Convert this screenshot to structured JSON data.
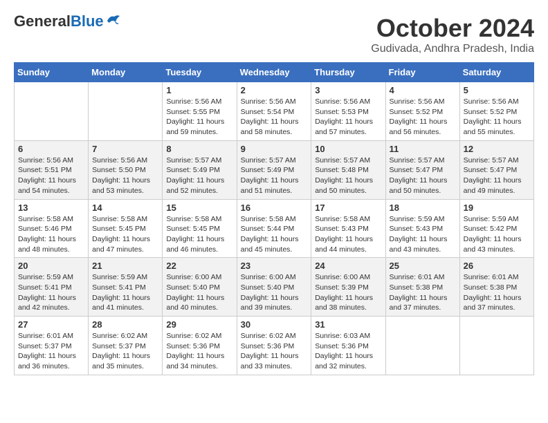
{
  "header": {
    "logo_general": "General",
    "logo_blue": "Blue",
    "month_title": "October 2024",
    "location": "Gudivada, Andhra Pradesh, India"
  },
  "days_of_week": [
    "Sunday",
    "Monday",
    "Tuesday",
    "Wednesday",
    "Thursday",
    "Friday",
    "Saturday"
  ],
  "weeks": [
    [
      {
        "day": "",
        "sunrise": "",
        "sunset": "",
        "daylight": ""
      },
      {
        "day": "",
        "sunrise": "",
        "sunset": "",
        "daylight": ""
      },
      {
        "day": "1",
        "sunrise": "Sunrise: 5:56 AM",
        "sunset": "Sunset: 5:55 PM",
        "daylight": "Daylight: 11 hours and 59 minutes."
      },
      {
        "day": "2",
        "sunrise": "Sunrise: 5:56 AM",
        "sunset": "Sunset: 5:54 PM",
        "daylight": "Daylight: 11 hours and 58 minutes."
      },
      {
        "day": "3",
        "sunrise": "Sunrise: 5:56 AM",
        "sunset": "Sunset: 5:53 PM",
        "daylight": "Daylight: 11 hours and 57 minutes."
      },
      {
        "day": "4",
        "sunrise": "Sunrise: 5:56 AM",
        "sunset": "Sunset: 5:52 PM",
        "daylight": "Daylight: 11 hours and 56 minutes."
      },
      {
        "day": "5",
        "sunrise": "Sunrise: 5:56 AM",
        "sunset": "Sunset: 5:52 PM",
        "daylight": "Daylight: 11 hours and 55 minutes."
      }
    ],
    [
      {
        "day": "6",
        "sunrise": "Sunrise: 5:56 AM",
        "sunset": "Sunset: 5:51 PM",
        "daylight": "Daylight: 11 hours and 54 minutes."
      },
      {
        "day": "7",
        "sunrise": "Sunrise: 5:56 AM",
        "sunset": "Sunset: 5:50 PM",
        "daylight": "Daylight: 11 hours and 53 minutes."
      },
      {
        "day": "8",
        "sunrise": "Sunrise: 5:57 AM",
        "sunset": "Sunset: 5:49 PM",
        "daylight": "Daylight: 11 hours and 52 minutes."
      },
      {
        "day": "9",
        "sunrise": "Sunrise: 5:57 AM",
        "sunset": "Sunset: 5:49 PM",
        "daylight": "Daylight: 11 hours and 51 minutes."
      },
      {
        "day": "10",
        "sunrise": "Sunrise: 5:57 AM",
        "sunset": "Sunset: 5:48 PM",
        "daylight": "Daylight: 11 hours and 50 minutes."
      },
      {
        "day": "11",
        "sunrise": "Sunrise: 5:57 AM",
        "sunset": "Sunset: 5:47 PM",
        "daylight": "Daylight: 11 hours and 50 minutes."
      },
      {
        "day": "12",
        "sunrise": "Sunrise: 5:57 AM",
        "sunset": "Sunset: 5:47 PM",
        "daylight": "Daylight: 11 hours and 49 minutes."
      }
    ],
    [
      {
        "day": "13",
        "sunrise": "Sunrise: 5:58 AM",
        "sunset": "Sunset: 5:46 PM",
        "daylight": "Daylight: 11 hours and 48 minutes."
      },
      {
        "day": "14",
        "sunrise": "Sunrise: 5:58 AM",
        "sunset": "Sunset: 5:45 PM",
        "daylight": "Daylight: 11 hours and 47 minutes."
      },
      {
        "day": "15",
        "sunrise": "Sunrise: 5:58 AM",
        "sunset": "Sunset: 5:45 PM",
        "daylight": "Daylight: 11 hours and 46 minutes."
      },
      {
        "day": "16",
        "sunrise": "Sunrise: 5:58 AM",
        "sunset": "Sunset: 5:44 PM",
        "daylight": "Daylight: 11 hours and 45 minutes."
      },
      {
        "day": "17",
        "sunrise": "Sunrise: 5:58 AM",
        "sunset": "Sunset: 5:43 PM",
        "daylight": "Daylight: 11 hours and 44 minutes."
      },
      {
        "day": "18",
        "sunrise": "Sunrise: 5:59 AM",
        "sunset": "Sunset: 5:43 PM",
        "daylight": "Daylight: 11 hours and 43 minutes."
      },
      {
        "day": "19",
        "sunrise": "Sunrise: 5:59 AM",
        "sunset": "Sunset: 5:42 PM",
        "daylight": "Daylight: 11 hours and 43 minutes."
      }
    ],
    [
      {
        "day": "20",
        "sunrise": "Sunrise: 5:59 AM",
        "sunset": "Sunset: 5:41 PM",
        "daylight": "Daylight: 11 hours and 42 minutes."
      },
      {
        "day": "21",
        "sunrise": "Sunrise: 5:59 AM",
        "sunset": "Sunset: 5:41 PM",
        "daylight": "Daylight: 11 hours and 41 minutes."
      },
      {
        "day": "22",
        "sunrise": "Sunrise: 6:00 AM",
        "sunset": "Sunset: 5:40 PM",
        "daylight": "Daylight: 11 hours and 40 minutes."
      },
      {
        "day": "23",
        "sunrise": "Sunrise: 6:00 AM",
        "sunset": "Sunset: 5:40 PM",
        "daylight": "Daylight: 11 hours and 39 minutes."
      },
      {
        "day": "24",
        "sunrise": "Sunrise: 6:00 AM",
        "sunset": "Sunset: 5:39 PM",
        "daylight": "Daylight: 11 hours and 38 minutes."
      },
      {
        "day": "25",
        "sunrise": "Sunrise: 6:01 AM",
        "sunset": "Sunset: 5:38 PM",
        "daylight": "Daylight: 11 hours and 37 minutes."
      },
      {
        "day": "26",
        "sunrise": "Sunrise: 6:01 AM",
        "sunset": "Sunset: 5:38 PM",
        "daylight": "Daylight: 11 hours and 37 minutes."
      }
    ],
    [
      {
        "day": "27",
        "sunrise": "Sunrise: 6:01 AM",
        "sunset": "Sunset: 5:37 PM",
        "daylight": "Daylight: 11 hours and 36 minutes."
      },
      {
        "day": "28",
        "sunrise": "Sunrise: 6:02 AM",
        "sunset": "Sunset: 5:37 PM",
        "daylight": "Daylight: 11 hours and 35 minutes."
      },
      {
        "day": "29",
        "sunrise": "Sunrise: 6:02 AM",
        "sunset": "Sunset: 5:36 PM",
        "daylight": "Daylight: 11 hours and 34 minutes."
      },
      {
        "day": "30",
        "sunrise": "Sunrise: 6:02 AM",
        "sunset": "Sunset: 5:36 PM",
        "daylight": "Daylight: 11 hours and 33 minutes."
      },
      {
        "day": "31",
        "sunrise": "Sunrise: 6:03 AM",
        "sunset": "Sunset: 5:36 PM",
        "daylight": "Daylight: 11 hours and 32 minutes."
      },
      {
        "day": "",
        "sunrise": "",
        "sunset": "",
        "daylight": ""
      },
      {
        "day": "",
        "sunrise": "",
        "sunset": "",
        "daylight": ""
      }
    ]
  ]
}
